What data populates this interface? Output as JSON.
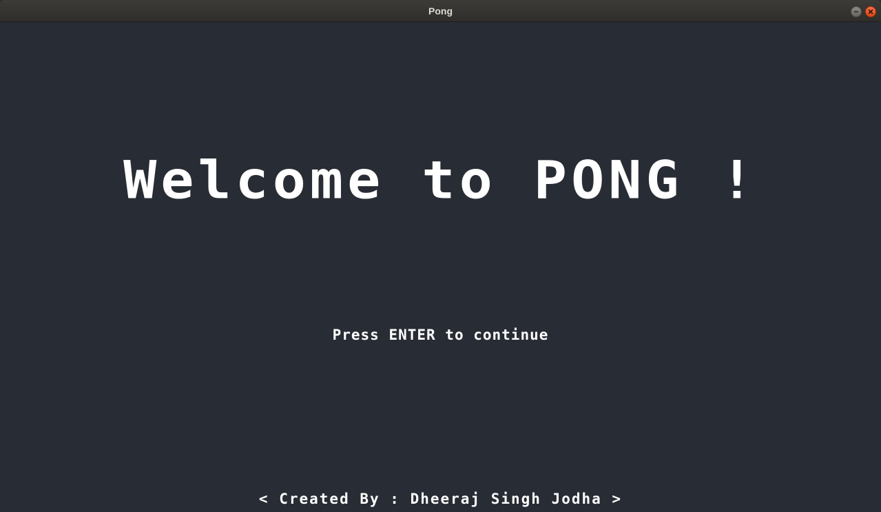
{
  "window": {
    "title": "Pong",
    "minimize_icon": "minimize-icon",
    "close_icon": "close-icon"
  },
  "screen": {
    "headline": "Welcome to PONG !",
    "prompt": "Press ENTER to continue",
    "credit": "< Created By : Dheeraj Singh Jodha >"
  },
  "colors": {
    "background": "#282c34",
    "text": "#ffffff",
    "titlebar": "#3c3b37",
    "close_button": "#e95420"
  }
}
